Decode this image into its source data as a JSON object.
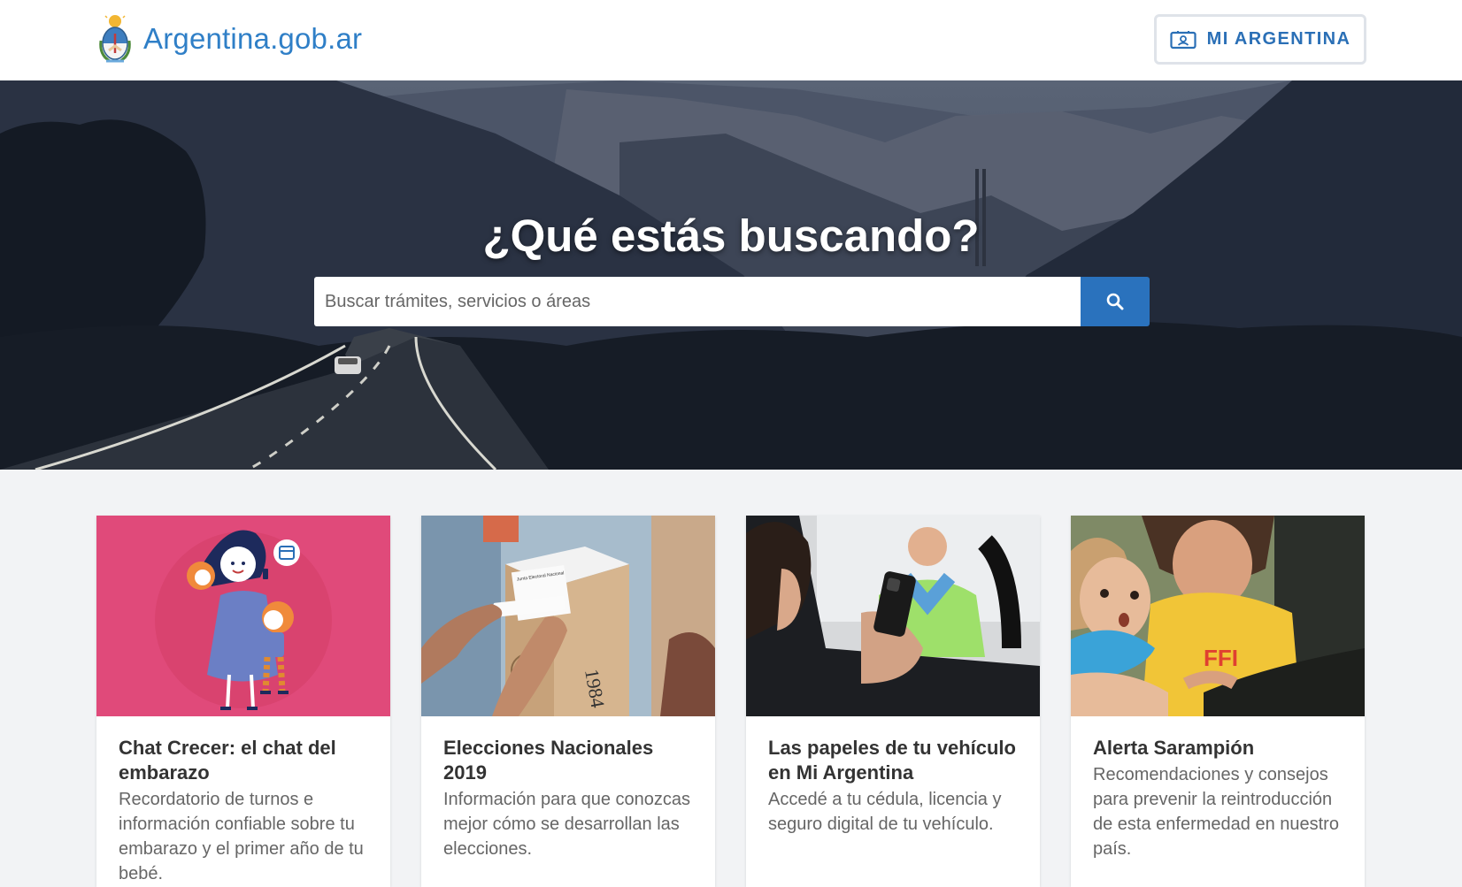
{
  "header": {
    "brand": "Argentina.gob.ar",
    "mi_argentina_label": "MI ARGENTINA"
  },
  "hero": {
    "title": "¿Qué estás buscando?",
    "search_placeholder": "Buscar trámites, servicios o áreas"
  },
  "cards": [
    {
      "title": "Chat Crecer: el chat del embarazo",
      "description": "Recordatorio de turnos e información confiable sobre tu embarazo y el primer año de tu bebé."
    },
    {
      "title": "Elecciones Nacionales 2019",
      "description": "Información para que conozcas mejor cómo se desarrollan las elecciones."
    },
    {
      "title": "Las papeles de tu vehículo en Mi Argentina",
      "description": "Accedé a tu cédula, licencia y seguro digital de tu vehículo."
    },
    {
      "title": "Alerta Sarampión",
      "description": "Recomendaciones y consejos para prevenir la reintroducción de esta enfermedad en nuestro país."
    }
  ],
  "image_text": {
    "ballot_box_label": "Junta Electoral Nacional",
    "ballot_box_number": "1984",
    "shirt_text": "FFI"
  },
  "colors": {
    "brand_blue": "#2f7fc7",
    "search_button": "#2a72bd",
    "card_pink": "#e04a7a"
  }
}
